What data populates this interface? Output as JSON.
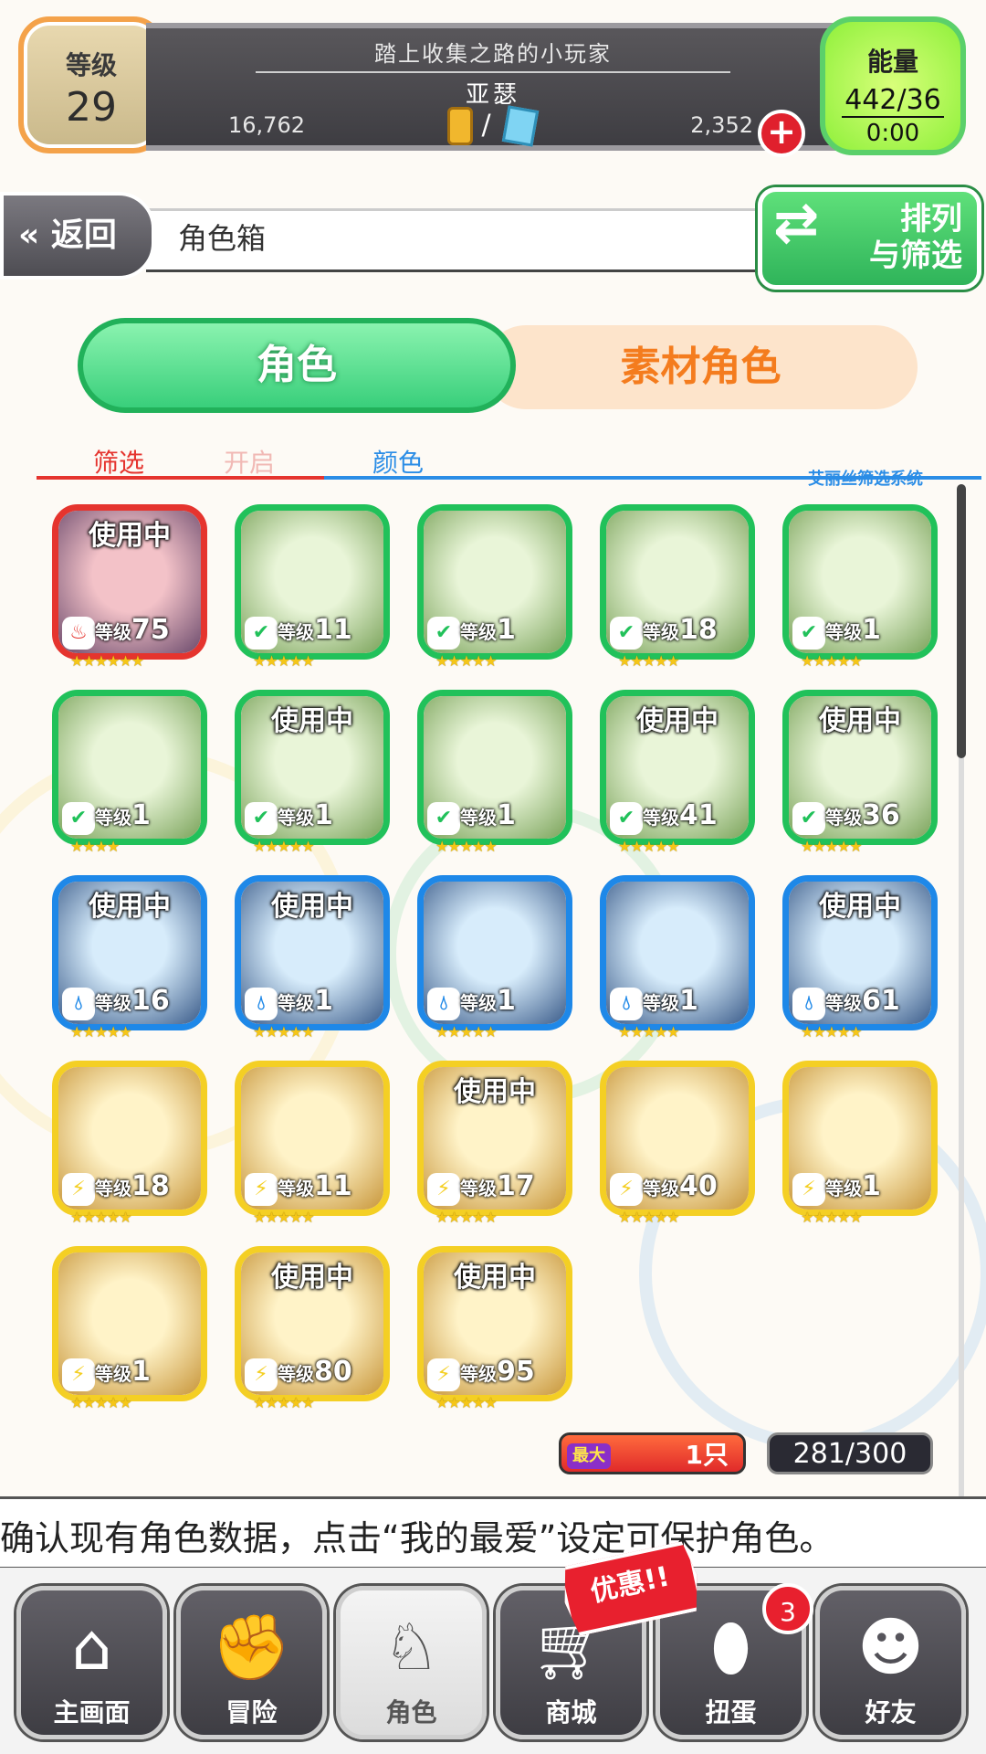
{
  "player": {
    "level_label": "等级",
    "level": "29",
    "motto": "踏上收集之路的小玩家",
    "name": "亚瑟",
    "coins": "16,762",
    "gems": "2,352",
    "currency_separator": "/"
  },
  "energy": {
    "label": "能量",
    "value": "442/36",
    "timer": "0:00"
  },
  "header": {
    "back_label": "返回",
    "title": "角色箱",
    "sort_label_1": "排列",
    "sort_label_2": "与筛选"
  },
  "tabs": [
    {
      "label": "角色",
      "active": true
    },
    {
      "label": "素材角色",
      "active": false
    }
  ],
  "filter": {
    "label": "筛选",
    "state": "开启",
    "color_label": "颜色",
    "system_label": "艾丽丝筛选系统"
  },
  "element_colors": {
    "fire": "#e5342e",
    "wood": "#21c15a",
    "water": "#1e88e8",
    "light": "#f4cf24"
  },
  "characters": [
    {
      "element": "fire",
      "icon": "fire-icon",
      "level": "75",
      "in_use": "使用中",
      "stars": 6
    },
    {
      "element": "wood",
      "icon": "leaf-icon",
      "level": "11",
      "in_use": "",
      "stars": 5
    },
    {
      "element": "wood",
      "icon": "leaf-icon",
      "level": "1",
      "in_use": "",
      "stars": 5
    },
    {
      "element": "wood",
      "icon": "leaf-icon",
      "level": "18",
      "in_use": "",
      "stars": 5
    },
    {
      "element": "wood",
      "icon": "leaf-icon",
      "level": "1",
      "in_use": "",
      "stars": 5
    },
    {
      "element": "wood",
      "icon": "leaf-icon",
      "level": "1",
      "in_use": "",
      "stars": 4
    },
    {
      "element": "wood",
      "icon": "leaf-icon",
      "level": "1",
      "in_use": "使用中",
      "stars": 5
    },
    {
      "element": "wood",
      "icon": "leaf-icon",
      "level": "1",
      "in_use": "",
      "stars": 5
    },
    {
      "element": "wood",
      "icon": "leaf-icon",
      "level": "41",
      "in_use": "使用中",
      "stars": 5
    },
    {
      "element": "wood",
      "icon": "leaf-icon",
      "level": "36",
      "in_use": "使用中",
      "stars": 5
    },
    {
      "element": "water",
      "icon": "water-drop-icon",
      "level": "16",
      "in_use": "使用中",
      "stars": 5
    },
    {
      "element": "water",
      "icon": "water-drop-icon",
      "level": "1",
      "in_use": "使用中",
      "stars": 5
    },
    {
      "element": "water",
      "icon": "water-drop-icon",
      "level": "1",
      "in_use": "",
      "stars": 5
    },
    {
      "element": "water",
      "icon": "water-drop-icon",
      "level": "1",
      "in_use": "",
      "stars": 5
    },
    {
      "element": "water",
      "icon": "water-drop-icon",
      "level": "61",
      "in_use": "使用中",
      "stars": 5
    },
    {
      "element": "light",
      "icon": "lightning-icon",
      "level": "18",
      "in_use": "",
      "stars": 5
    },
    {
      "element": "light",
      "icon": "lightning-icon",
      "level": "11",
      "in_use": "",
      "stars": 5
    },
    {
      "element": "light",
      "icon": "lightning-icon",
      "level": "17",
      "in_use": "使用中",
      "stars": 5
    },
    {
      "element": "light",
      "icon": "lightning-icon",
      "level": "40",
      "in_use": "",
      "stars": 5
    },
    {
      "element": "light",
      "icon": "lightning-icon",
      "level": "1",
      "in_use": "",
      "stars": 5
    },
    {
      "element": "light",
      "icon": "lightning-icon",
      "level": "1",
      "in_use": "",
      "stars": 5
    },
    {
      "element": "light",
      "icon": "lightning-icon",
      "level": "80",
      "in_use": "使用中",
      "stars": 5
    },
    {
      "element": "light",
      "icon": "lightning-icon",
      "level": "95",
      "in_use": "使用中",
      "stars": 5
    }
  ],
  "level_prefix": "等级",
  "favorite": {
    "label": "最大",
    "value": "1只"
  },
  "box_count": "281/300",
  "hint": "确认现有角色数据，点击“我的最爱”设定可保护角色。",
  "nav": [
    {
      "label": "主画面",
      "icon": "home-icon",
      "active": false
    },
    {
      "label": "冒险",
      "icon": "handshake-icon",
      "active": false
    },
    {
      "label": "角色",
      "icon": "rabbit-icon",
      "active": true
    },
    {
      "label": "商城",
      "icon": "cart-icon",
      "active": false
    },
    {
      "label": "扭蛋",
      "icon": "egg-icon",
      "active": false
    },
    {
      "label": "好友",
      "icon": "friends-icon",
      "active": false
    }
  ],
  "sale_badge": "优惠!!",
  "gacha_notification": "3"
}
